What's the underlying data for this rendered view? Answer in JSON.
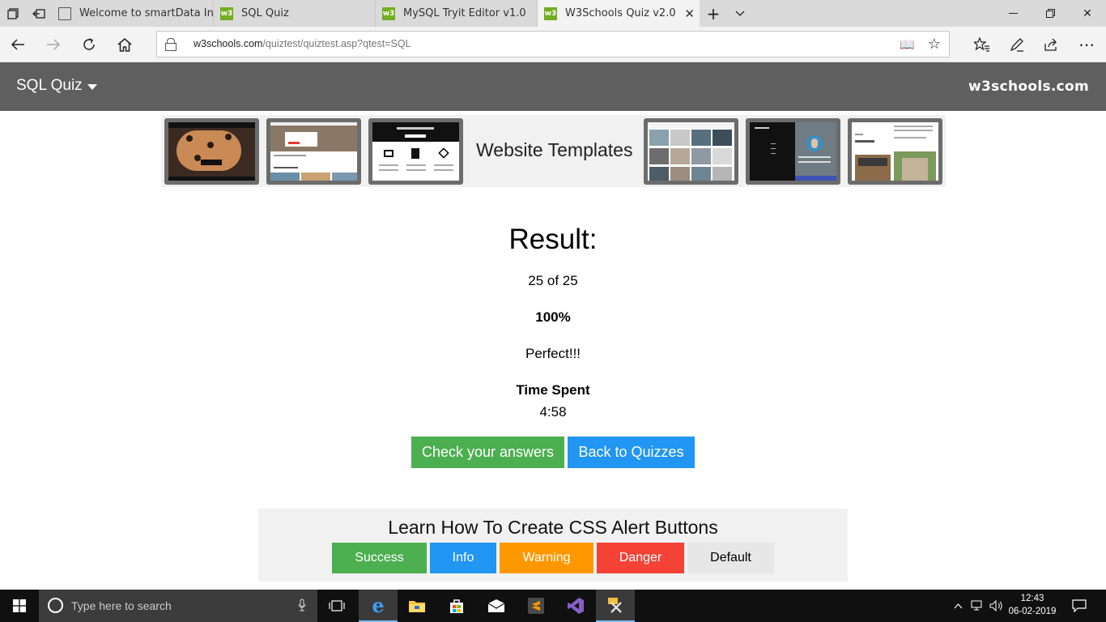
{
  "browser": {
    "tabs": [
      {
        "title": "Welcome to smartData Inte",
        "icon": "page-icon"
      },
      {
        "title": "SQL Quiz",
        "icon": "w3-icon"
      },
      {
        "title": "MySQL Tryit Editor v1.0",
        "icon": "w3-icon"
      },
      {
        "title": "W3Schools Quiz v2.0",
        "icon": "w3-icon",
        "active": true
      }
    ],
    "url_host": "w3schools.com",
    "url_path": "/quiztest/quiztest.asp?qtest=SQL"
  },
  "site": {
    "menu_label": "SQL Quiz",
    "brand": "w3schools.com"
  },
  "banner": {
    "title": "Website Templates"
  },
  "result": {
    "title": "Result:",
    "score": "25 of 25",
    "percent": "100%",
    "comment": "Perfect!!!",
    "time_label": "Time Spent",
    "time_value": "4:58",
    "check_button": "Check your answers",
    "back_button": "Back to Quizzes"
  },
  "alerts": {
    "title": "Learn How To Create CSS Alert Buttons",
    "buttons": [
      {
        "label": "Success",
        "color": "#4caf50"
      },
      {
        "label": "Info",
        "color": "#2196f3"
      },
      {
        "label": "Warning",
        "color": "#ff9800"
      },
      {
        "label": "Danger",
        "color": "#f44336"
      },
      {
        "label": "Default",
        "color": "#e7e7e7"
      }
    ]
  },
  "taskbar": {
    "search_placeholder": "Type here to search",
    "time": "12:43",
    "date": "06-02-2019"
  }
}
